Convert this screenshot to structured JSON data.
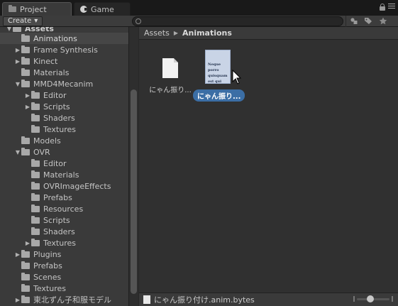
{
  "tabs": [
    {
      "label": "Project",
      "icon": "folder-icon",
      "active": true
    },
    {
      "label": "Game",
      "icon": "pacman-icon",
      "active": false
    }
  ],
  "toolbar": {
    "create_label": "Create",
    "create_caret": "▾",
    "search": {
      "value": "",
      "placeholder": ""
    },
    "icons": [
      "filter-type-icon",
      "label-tag-icon",
      "favorite-star-icon"
    ]
  },
  "tree": {
    "root": "Assets",
    "items": [
      {
        "label": "Animations",
        "depth": 1,
        "expanded": null,
        "selected": true
      },
      {
        "label": "Frame Synthesis",
        "depth": 1,
        "expanded": false
      },
      {
        "label": "Kinect",
        "depth": 1,
        "expanded": false
      },
      {
        "label": "Materials",
        "depth": 1,
        "expanded": null
      },
      {
        "label": "MMD4Mecanim",
        "depth": 1,
        "expanded": true
      },
      {
        "label": "Editor",
        "depth": 2,
        "expanded": false
      },
      {
        "label": "Scripts",
        "depth": 2,
        "expanded": false
      },
      {
        "label": "Shaders",
        "depth": 2,
        "expanded": null
      },
      {
        "label": "Textures",
        "depth": 2,
        "expanded": null
      },
      {
        "label": "Models",
        "depth": 1,
        "expanded": null
      },
      {
        "label": "OVR",
        "depth": 1,
        "expanded": true
      },
      {
        "label": "Editor",
        "depth": 2,
        "expanded": null
      },
      {
        "label": "Materials",
        "depth": 2,
        "expanded": null
      },
      {
        "label": "OVRImageEffects",
        "depth": 2,
        "expanded": null
      },
      {
        "label": "Prefabs",
        "depth": 2,
        "expanded": null
      },
      {
        "label": "Resources",
        "depth": 2,
        "expanded": null
      },
      {
        "label": "Scripts",
        "depth": 2,
        "expanded": null
      },
      {
        "label": "Shaders",
        "depth": 2,
        "expanded": null
      },
      {
        "label": "Textures",
        "depth": 2,
        "expanded": false
      },
      {
        "label": "Plugins",
        "depth": 1,
        "expanded": false
      },
      {
        "label": "Prefabs",
        "depth": 1,
        "expanded": null
      },
      {
        "label": "Scenes",
        "depth": 1,
        "expanded": null
      },
      {
        "label": "Textures",
        "depth": 1,
        "expanded": null
      },
      {
        "label": "東北ずん子和服モデル",
        "depth": 1,
        "expanded": false
      }
    ]
  },
  "breadcrumb": {
    "root": "Assets",
    "separator": "▶",
    "current": "Animations"
  },
  "assets": [
    {
      "label": "にゃん振り...",
      "icon": "document-icon",
      "selected": false
    },
    {
      "label": "にゃん振り...",
      "icon": "text-asset-icon",
      "selected": true,
      "preview": "Neque porro quisquam est qui dolorem"
    }
  ],
  "status": {
    "selected_file": "にゃん振り付け.anim.bytes"
  },
  "colors": {
    "selection": "#3b6ea5",
    "panel": "#3a3a3a",
    "background": "#282828"
  }
}
